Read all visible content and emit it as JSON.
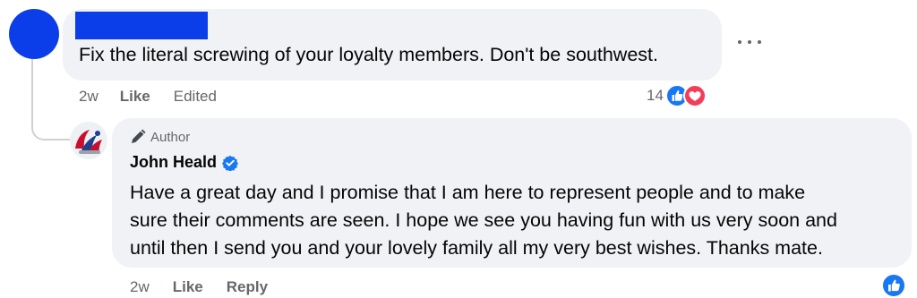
{
  "first_comment": {
    "author_redacted": true,
    "avatar_color": "#0b3ee9",
    "text": "Fix the literal screwing of your loyalty members. Don't be southwest.",
    "time": "2w",
    "like_label": "Like",
    "edited_label": "Edited",
    "reaction_count": "14",
    "reaction_icons": [
      "like-icon",
      "love-icon"
    ],
    "more_icon": "ellipsis-icon"
  },
  "reply": {
    "badge_label": "Author",
    "badge_icon": "pen-icon",
    "author_name": "John Heald",
    "verified_icon": "verified-badge-icon",
    "text_lines": [
      "Have a great day and I promise that I am here to represent people and to make",
      "sure their comments are seen. I hope we see you having fun with us very soon and",
      "until then I send you and your lovely family all my very best wishes. Thanks mate."
    ],
    "time": "2w",
    "like_label": "Like",
    "reply_label": "Reply",
    "reaction_icon": "like-icon"
  },
  "colors": {
    "bubble_bg": "#f0f2f5",
    "meta_text": "#65676b",
    "like_blue": "#1877f2",
    "love_red": "#f33e58",
    "redaction_blue": "#0b3ee9"
  }
}
